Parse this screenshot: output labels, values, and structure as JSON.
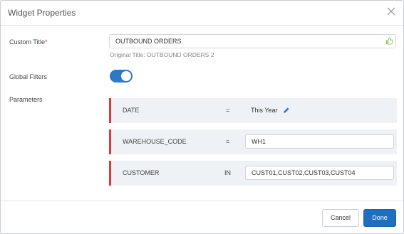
{
  "dialog": {
    "title": "Widget Properties"
  },
  "custom_title": {
    "label": "Custom Title",
    "required_mark": "*",
    "value": "OUTBOUND ORDERS",
    "hint": "Original Title: OUTBOUND ORDERS 2"
  },
  "global_filters": {
    "label": "Global Filters",
    "enabled": true
  },
  "parameters": {
    "label": "Parameters",
    "rows": [
      {
        "name": "DATE",
        "operator": "=",
        "value": "This Year"
      },
      {
        "name": "WAREHOUSE_CODE",
        "operator": "=",
        "value": "WH1"
      },
      {
        "name": "CUSTOMER",
        "operator": "IN",
        "value": "CUST01,CUST02,CUST03,CUST04"
      }
    ]
  },
  "footer": {
    "cancel_label": "Cancel",
    "done_label": "Done"
  },
  "colors": {
    "accent": "#1f6fc0",
    "toggle": "#2e78c8",
    "required": "#e53935",
    "row_bg": "#eef1f5"
  },
  "icons": {
    "close": "close-icon",
    "thumbs_up": "thumbs-up-icon",
    "edit": "pencil-icon"
  }
}
